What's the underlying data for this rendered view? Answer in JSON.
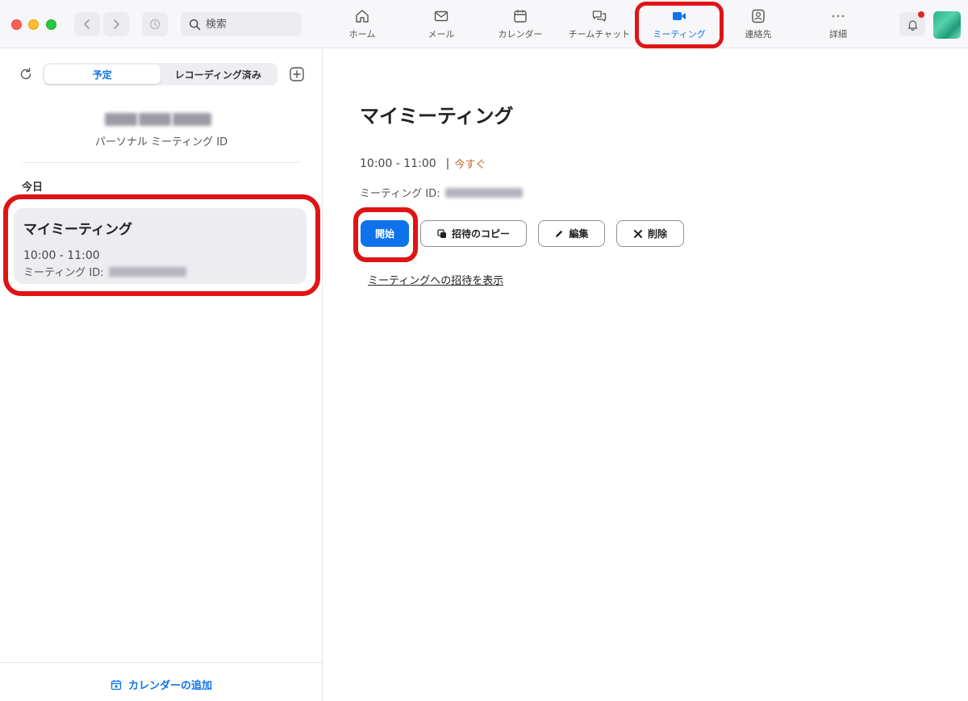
{
  "header": {
    "search_placeholder": "検索",
    "tabs": [
      {
        "label": "ホーム",
        "icon": "home-icon"
      },
      {
        "label": "メール",
        "icon": "mail-icon"
      },
      {
        "label": "カレンダー",
        "icon": "calendar-icon"
      },
      {
        "label": "チームチャット",
        "icon": "chat-icon"
      },
      {
        "label": "ミーティング",
        "icon": "video-camera-icon",
        "active": true
      },
      {
        "label": "連絡先",
        "icon": "contacts-icon"
      },
      {
        "label": "詳細",
        "icon": "more-icon"
      }
    ],
    "accent_color": "#0e72ed",
    "notification_dot_color": "#e02828"
  },
  "sidebar": {
    "segments": [
      {
        "label": "予定",
        "active": true
      },
      {
        "label": "レコーディング済み",
        "active": false
      }
    ],
    "personal_meeting_id_label": "パーソナル ミーティング ID",
    "section_today": "今日",
    "meeting_card": {
      "title": "マイミーティング",
      "time": "10:00 - 11:00",
      "id_label": "ミーティング ID:"
    },
    "add_calendar_label": "カレンダーの追加"
  },
  "detail": {
    "title": "マイミーティング",
    "time": "10:00 - 11:00",
    "separator": "|",
    "now_label": "今すぐ",
    "id_label": "ミーティング ID:",
    "buttons": {
      "start": "開始",
      "copy_invite": "招待のコピー",
      "edit": "編集",
      "delete": "削除"
    },
    "show_invite_link": "ミーティングへの招待を表示"
  },
  "annotations": {
    "highlight_color": "#e01414"
  }
}
